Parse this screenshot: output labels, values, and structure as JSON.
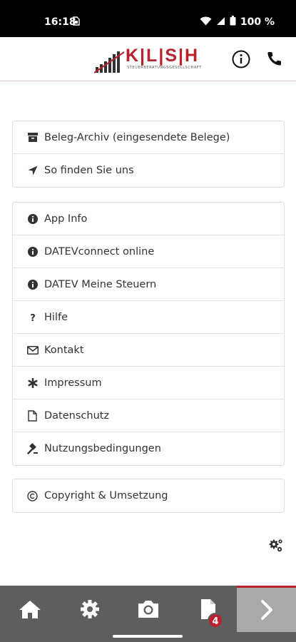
{
  "status_bar": {
    "time": "16:18",
    "battery": "100 %",
    "icons": [
      "sim-icon",
      "wifi-icon",
      "signal-icon",
      "battery-icon"
    ]
  },
  "header": {
    "logo_text": "K|L|S|H",
    "logo_subtitle": "STEUERBERATUNGSGESELLSCHAFT",
    "brand_color": "#b8212d",
    "icons": [
      "info-circle-icon",
      "phone-icon"
    ]
  },
  "groups": [
    {
      "items": [
        {
          "label": "Beleg-Archiv (eingesendete Belege)",
          "icon": "archive-icon"
        },
        {
          "label": "So finden Sie uns",
          "icon": "location-arrow-icon"
        }
      ]
    },
    {
      "items": [
        {
          "label": "App Info",
          "icon": "info-icon"
        },
        {
          "label": "DATEVconnect online",
          "icon": "info-icon"
        },
        {
          "label": "DATEV Meine Steuern",
          "icon": "info-icon"
        },
        {
          "label": "Hilfe",
          "icon": "question-icon"
        },
        {
          "label": "Kontakt",
          "icon": "envelope-icon"
        },
        {
          "label": "Impressum",
          "icon": "asterisk-icon"
        },
        {
          "label": "Datenschutz",
          "icon": "document-icon"
        },
        {
          "label": "Nutzungsbedingungen",
          "icon": "gavel-icon"
        }
      ]
    },
    {
      "items": [
        {
          "label": "Copyright & Umsetzung",
          "icon": "copyright-icon"
        }
      ]
    }
  ],
  "settings_icon": "gears-icon",
  "bottom_nav": {
    "items": [
      "home-icon",
      "settings-icon",
      "camera-icon",
      "documents-icon",
      "chevron-right-icon"
    ],
    "documents_badge": "4",
    "bar_color": "#5e5e5e",
    "active_color": "#a9a9a9"
  }
}
